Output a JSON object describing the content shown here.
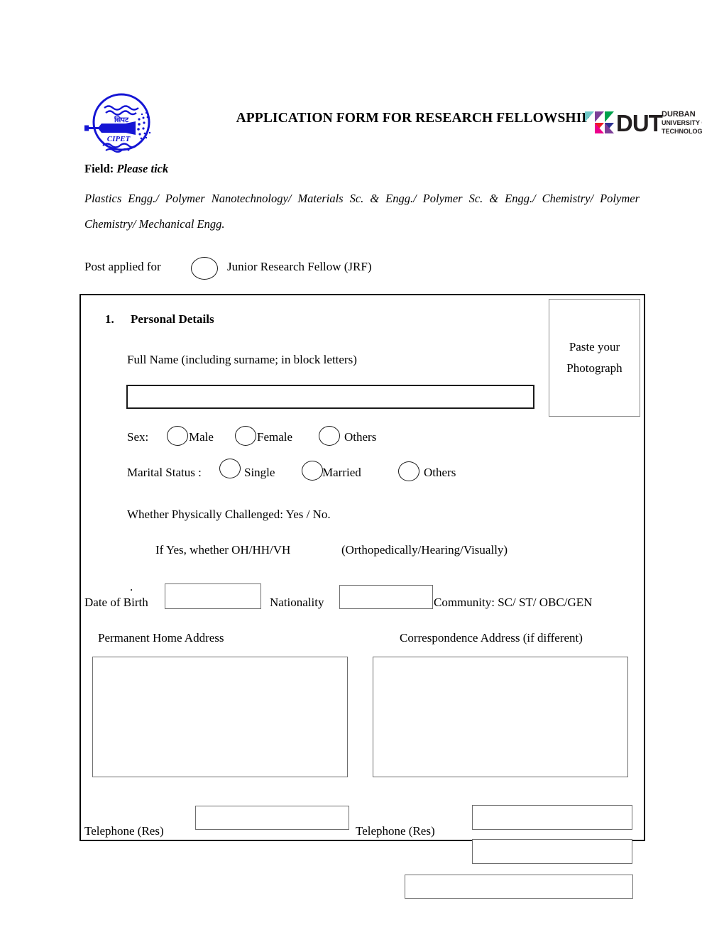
{
  "header": {
    "title": "APPLICATION FORM FOR RESEARCH FELLOWSHIP",
    "left_logo": {
      "name": "cipet-logo",
      "text": "CIPET",
      "color": "#1515d4"
    },
    "right_logo": {
      "name": "dut-logo",
      "acronym": "DUT",
      "line1": "DURBAN",
      "line2": "UNIVERSITY OF",
      "line3": "TECHNOLOGY",
      "colors": [
        "#6fc8c8",
        "#7d3f98",
        "#00a14b",
        "#2e3192",
        "#ed1c24",
        "#ec008c",
        "#231f20"
      ]
    }
  },
  "field": {
    "label_bold": "Field:",
    "label_italic": "Please tick",
    "options_text": "Plastics Engg./ Polymer Nanotechnology/ Materials Sc. & Engg./ Polymer Sc. & Engg./ Chemistry/ Polymer Chemistry/ Mechanical Engg."
  },
  "post": {
    "label": "Post applied for",
    "option_label": "Junior Research Fellow (JRF)"
  },
  "personal": {
    "number": "1.",
    "title": "Personal Details",
    "photo_line1": "Paste your",
    "photo_line2": "Photograph",
    "fullname_label": "Full Name (including surname; in block letters)",
    "fullname_value": "",
    "sex": {
      "label": "Sex:",
      "options": [
        "Male",
        "Female",
        "Others"
      ]
    },
    "marital": {
      "label": "Marital Status :",
      "options": [
        "Single",
        "Married",
        "Others"
      ]
    },
    "physically_challenged": "Whether Physically Challenged: Yes / No.",
    "if_yes_label": "If Yes, whether OH/HH/VH",
    "if_yes_expansion": "(Orthopedically/Hearing/Visually)",
    "dot_mark": ".",
    "dob_label": "Date of Birth",
    "dob_value": "",
    "nationality_label": "Nationality",
    "nationality_value": "",
    "community_label": "Community:  SC/ ST/ OBC/GEN",
    "address_permanent_label": "Permanent Home Address",
    "address_permanent_value": "",
    "address_correspondence_label": "Correspondence Address (if different)",
    "address_correspondence_value": "",
    "telephone_res_label_left": "Telephone (Res)",
    "telephone_res_value_left": "",
    "telephone_res_label_right": "Telephone (Res)",
    "telephone_res_value_right": "",
    "extra_field_1": "",
    "extra_field_2": ""
  }
}
